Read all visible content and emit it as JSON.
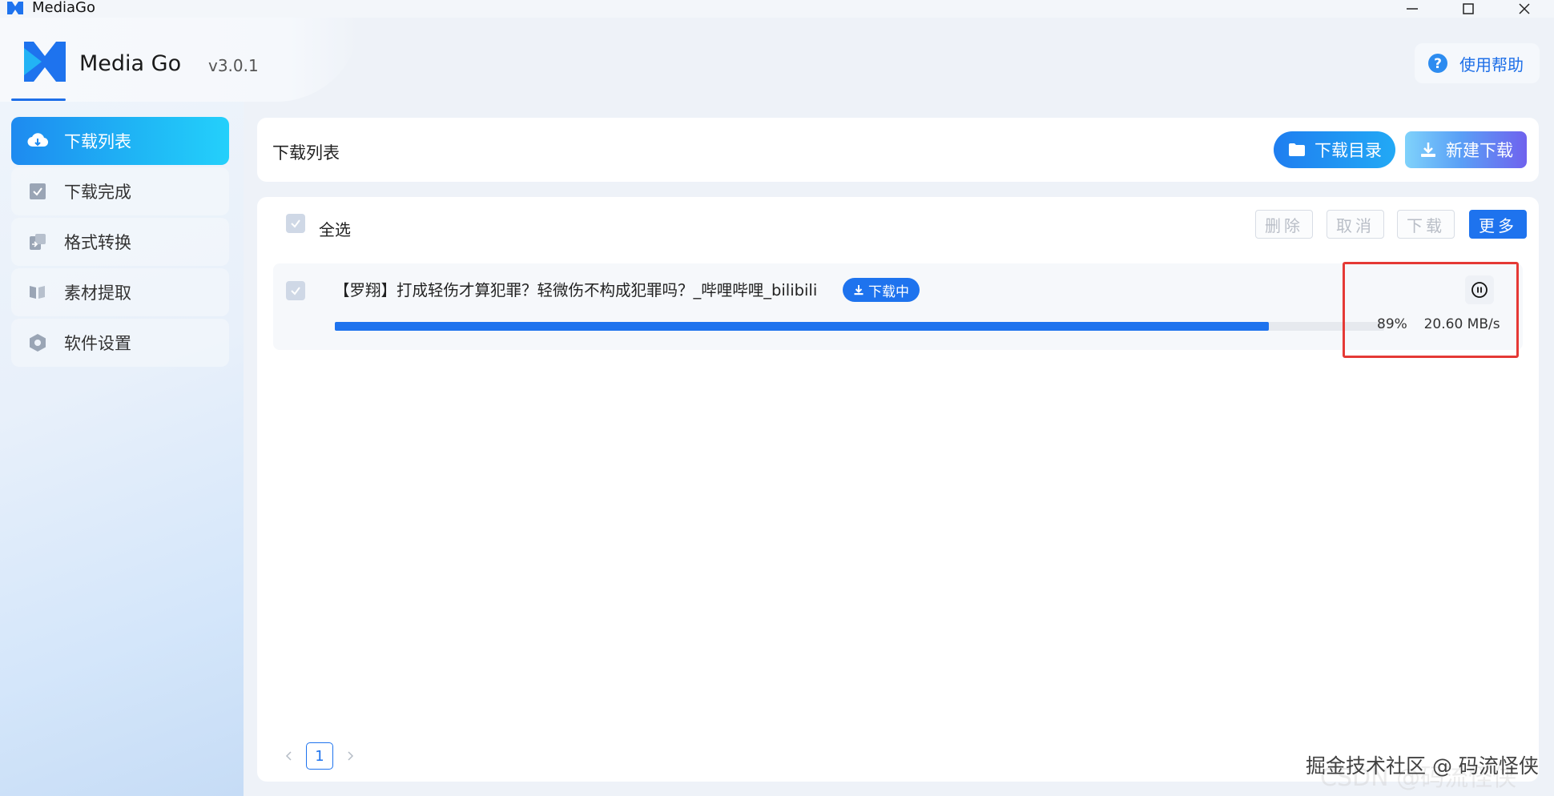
{
  "window": {
    "title": "MediaGo"
  },
  "header": {
    "logo_text": "Media Go",
    "version": "v3.0.1",
    "help_label": "使用帮助"
  },
  "sidebar": {
    "items": [
      {
        "label": "下载列表",
        "icon": "cloud-download-icon",
        "active": true
      },
      {
        "label": "下载完成",
        "icon": "check-square-icon",
        "active": false
      },
      {
        "label": "格式转换",
        "icon": "convert-icon",
        "active": false
      },
      {
        "label": "素材提取",
        "icon": "extract-icon",
        "active": false
      },
      {
        "label": "软件设置",
        "icon": "settings-hexagon-icon",
        "active": false
      }
    ]
  },
  "content": {
    "title": "下载列表",
    "download_dir_label": "下载目录",
    "new_download_label": "新建下载"
  },
  "list": {
    "select_all_label": "全选",
    "actions": {
      "delete": "删除",
      "cancel": "取消",
      "download": "下载",
      "more": "更多"
    },
    "tasks": [
      {
        "title": "【罗翔】打成轻伤才算犯罪？轻微伤不构成犯罪吗？_哔哩哔哩_bilibili",
        "status": "下载中",
        "progress_percent": 89,
        "progress_label": "89%",
        "speed": "20.60 MB/s"
      }
    ]
  },
  "pagination": {
    "current_page": "1"
  },
  "watermark": "掘金技术社区 @ 码流怪侠",
  "watermark_ghost": "CSDN @码流怪侠",
  "colors": {
    "accent": "#1e73ee",
    "highlight": "#e53935"
  }
}
